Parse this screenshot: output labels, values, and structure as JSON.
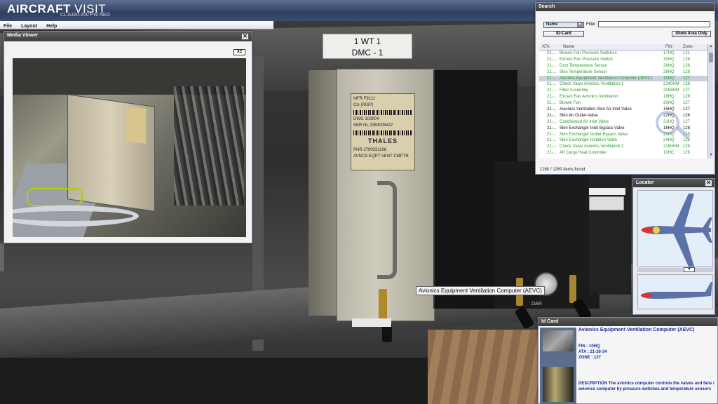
{
  "app": {
    "title_bold": "AIRCRAFT",
    "title_light": " VISIT",
    "subtitle": "CL A320-200 PW NEO",
    "menu": [
      "File",
      "Layout",
      "Help"
    ]
  },
  "scene": {
    "rack_label_line1": "1 WT 1",
    "rack_label_line2": "DMC - 1",
    "tooltip": "Avionics Equipment Ventilation Computer (AEVC)",
    "plate": {
      "mfr": "MFR F9111",
      "cls": "Cls (RISP)",
      "dwg": "DWG 103004",
      "ser": "SER NL 2063005447",
      "brand": "THALES",
      "pnr": "PNR 2790331108",
      "name": "AVNCS EQPT VENT CMPTR"
    },
    "unit_label": "DAR"
  },
  "media_viewer": {
    "title": "Media Viewer",
    "zoom_button": "X2",
    "close": "✕"
  },
  "search": {
    "title": "Search",
    "mode_select": "Name",
    "filter_label": "Filter :",
    "filter_value": "",
    "id_card_button": "ID-Card",
    "show_area_button": "Show Area Only",
    "columns": {
      "ata": "ATA",
      "name": "Name",
      "fin": "FIN",
      "zone": "Zone"
    },
    "rows": [
      {
        "ata": "21-...",
        "name": "Blower Fan Pressure Switches",
        "fin": "17HQ",
        "zone": "121",
        "style": "green"
      },
      {
        "ata": "21-...",
        "name": "Extract Fan Pressure Switch",
        "fin": "30HQ",
        "zone": "128",
        "style": "green"
      },
      {
        "ata": "21-...",
        "name": "Duct Temperature Sensor",
        "fin": "26HQ",
        "zone": "128",
        "style": "green"
      },
      {
        "ata": "21-...",
        "name": "Skin Temperature Sensor",
        "fin": "29HQ",
        "zone": "128",
        "style": "green"
      },
      {
        "ata": "21-...",
        "name": "Avionics Equipment Ventilation Computer (AEVC)",
        "fin": "10HQ",
        "zone": "127",
        "style": "selected"
      },
      {
        "ata": "21-...",
        "name": "Check Valve Avionics Ventilation 1",
        "fin": "2140HM",
        "zone": "128",
        "style": "green"
      },
      {
        "ata": "21-...",
        "name": "Filter Assembly",
        "fin": "2083HM",
        "zone": "127",
        "style": "green"
      },
      {
        "ata": "21-...",
        "name": "Extract Fan Avionics Ventilation",
        "fin": "18HQ",
        "zone": "128",
        "style": "green"
      },
      {
        "ata": "21-...",
        "name": "Blower Fan",
        "fin": "20HQ",
        "zone": "127",
        "style": "green"
      },
      {
        "ata": "21-...",
        "name": "Avionics Ventilation Skin Air Inlet Valve",
        "fin": "15HQ",
        "zone": "127",
        "style": "black"
      },
      {
        "ata": "21-...",
        "name": "Skin Air Outlet-Valve",
        "fin": "22HQ",
        "zone": "126",
        "style": "black"
      },
      {
        "ata": "21-...",
        "name": "Conditioned Air Inlet Valve",
        "fin": "21HQ",
        "zone": "127",
        "style": "green"
      },
      {
        "ata": "21-...",
        "name": "Skin Exchanger Inlet Bypass Valve",
        "fin": "16HQ",
        "zone": "128",
        "style": "black"
      },
      {
        "ata": "21-...",
        "name": "Skin Exchanger Outlet Bypass Valve",
        "fin": "23HQ",
        "zone": "125",
        "style": "green"
      },
      {
        "ata": "21-...",
        "name": "Skin Exchanger Isolation Valve",
        "fin": "24HQ",
        "zone": "126",
        "style": "green"
      },
      {
        "ata": "21-...",
        "name": "Check Valve Avionics Ventilation 2",
        "fin": "2180HM",
        "zone": "125",
        "style": "green"
      },
      {
        "ata": "21-...",
        "name": "Aft Cargo Heat Controller",
        "fin": "10HC",
        "zone": "126",
        "style": "green"
      }
    ],
    "count_text": "1260 / 1260 items found"
  },
  "locator": {
    "title": "Locator",
    "close": "✕",
    "slider_arrow": "▼"
  },
  "idcard": {
    "title": "Id Card",
    "name": "Avionics Equipment Ventilation Computer (AEVC)",
    "fin": "FIN : 10HQ",
    "ata": "ATA : 21-26-34",
    "zone": "ZONE : 127",
    "desc_line1": "DESCRIPTION The avionics computer controls the valves and fans i",
    "desc_line2": "avionics computer by pressure switches and temperature sensors"
  },
  "colors": {
    "title_bar": "#2f3f62",
    "row_green": "#2a9a2a",
    "row_selected": "#c9d1de",
    "idcard_text": "#1a2aa0",
    "aircraft_fuselage": "#5b73a8",
    "aircraft_highlight": "#e23030"
  }
}
